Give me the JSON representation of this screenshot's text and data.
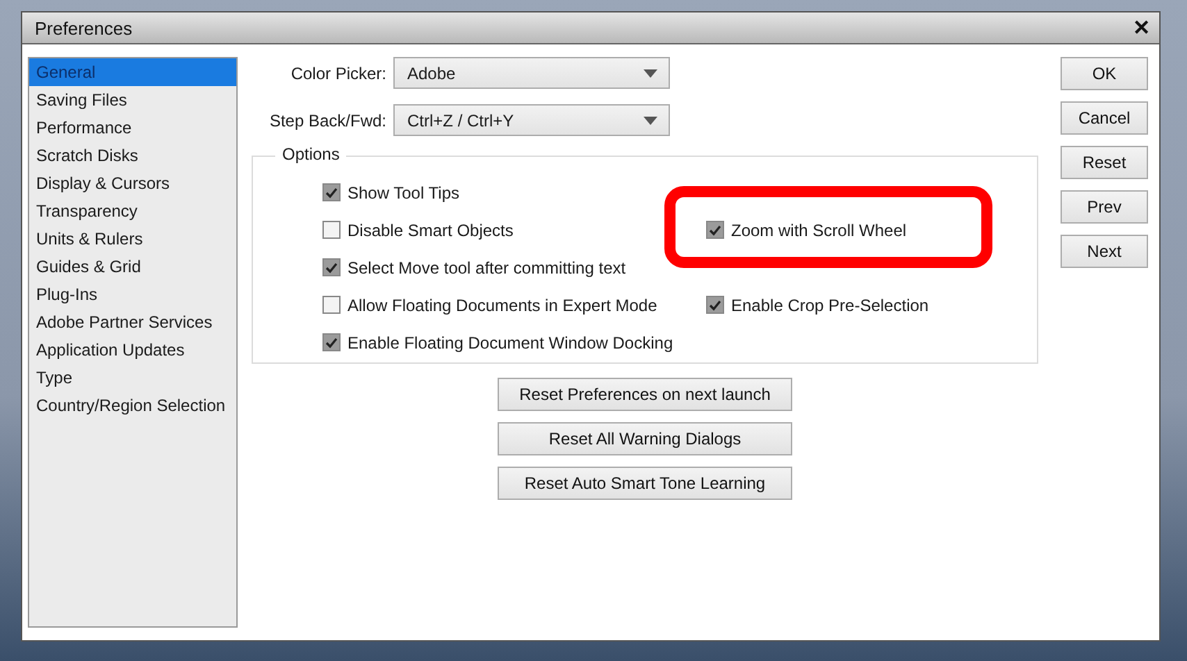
{
  "window": {
    "title": "Preferences",
    "close": "✕"
  },
  "sidebar": {
    "items": [
      {
        "label": "General",
        "selected": true
      },
      {
        "label": "Saving Files",
        "selected": false
      },
      {
        "label": "Performance",
        "selected": false
      },
      {
        "label": "Scratch Disks",
        "selected": false
      },
      {
        "label": "Display & Cursors",
        "selected": false
      },
      {
        "label": "Transparency",
        "selected": false
      },
      {
        "label": "Units & Rulers",
        "selected": false
      },
      {
        "label": "Guides & Grid",
        "selected": false
      },
      {
        "label": "Plug-Ins",
        "selected": false
      },
      {
        "label": "Adobe Partner Services",
        "selected": false
      },
      {
        "label": "Application Updates",
        "selected": false
      },
      {
        "label": "Type",
        "selected": false
      },
      {
        "label": "Country/Region Selection",
        "selected": false
      }
    ]
  },
  "fields": [
    {
      "label": "Color Picker:",
      "value": "Adobe"
    },
    {
      "label": "Step Back/Fwd:",
      "value": "Ctrl+Z / Ctrl+Y"
    }
  ],
  "options": {
    "title": "Options",
    "left": [
      {
        "label": "Show Tool Tips",
        "checked": true
      },
      {
        "label": "Disable Smart Objects",
        "checked": false
      },
      {
        "label": "Select Move tool after committing text",
        "checked": true
      },
      {
        "label": "Allow Floating Documents in Expert Mode",
        "checked": false
      },
      {
        "label": "Enable Floating Document Window Docking",
        "checked": true
      }
    ],
    "right": [
      {
        "label": "Zoom with Scroll Wheel",
        "checked": true
      },
      {
        "label": "Enable Crop Pre-Selection",
        "checked": true
      }
    ]
  },
  "reset_buttons": [
    "Reset Preferences on next launch",
    "Reset All Warning Dialogs",
    "Reset Auto Smart Tone Learning"
  ],
  "buttons": [
    "OK",
    "Cancel",
    "Reset",
    "Prev",
    "Next"
  ]
}
